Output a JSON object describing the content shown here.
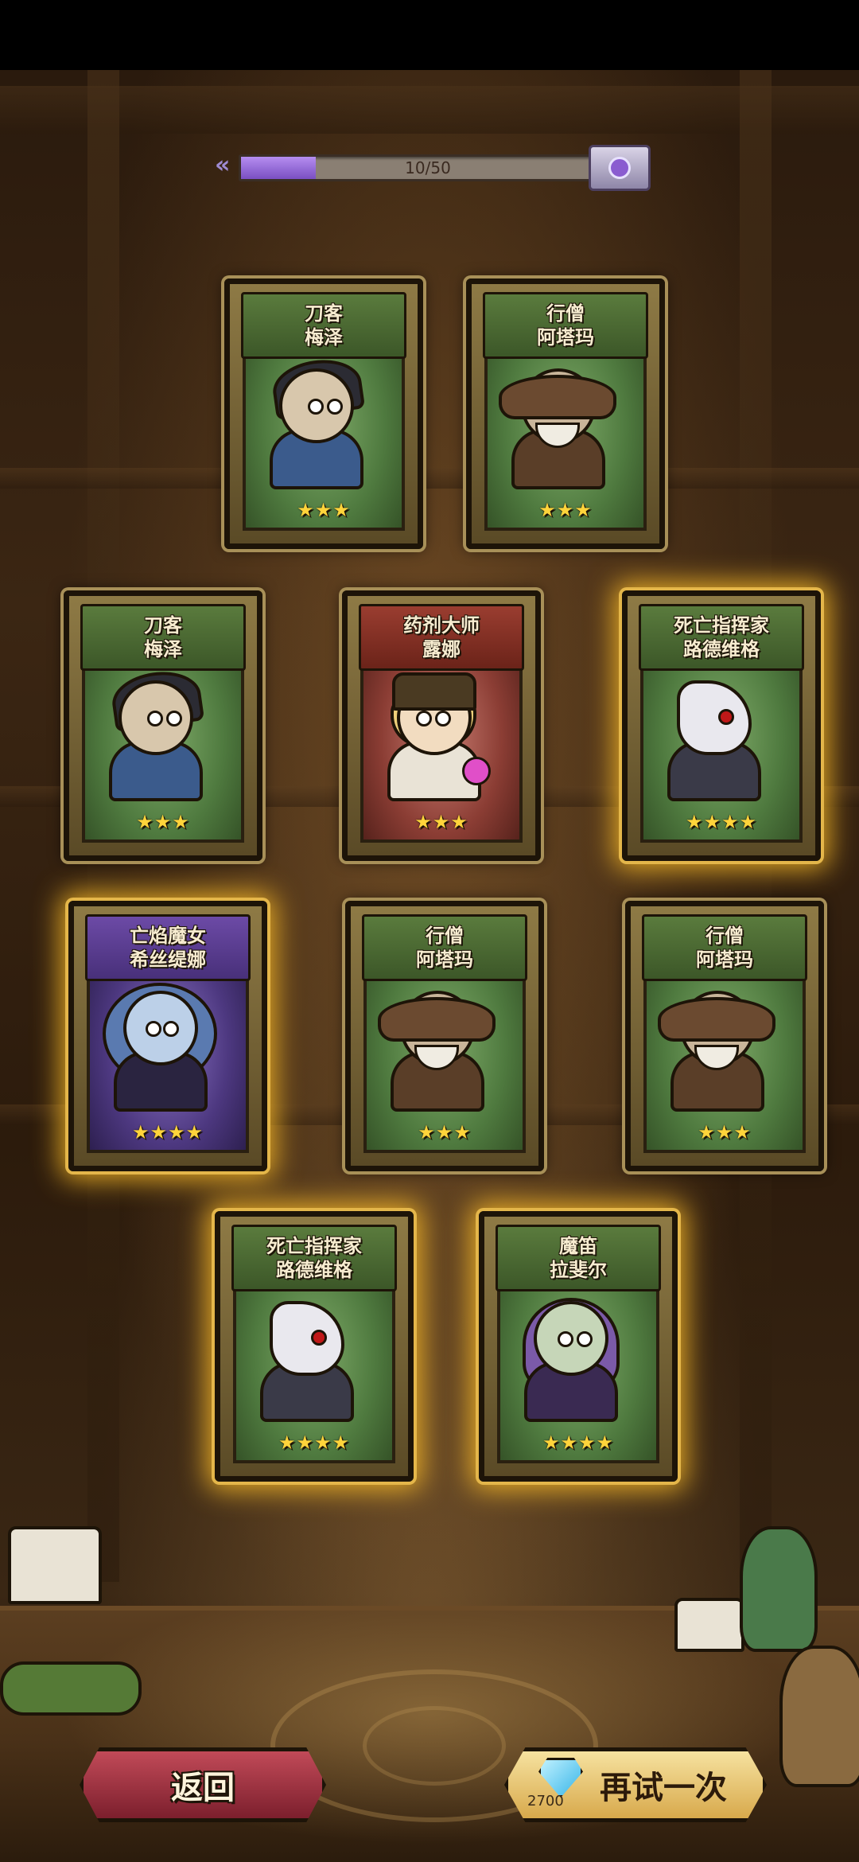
{
  "progress": {
    "text": "10/50",
    "fraction": 0.2
  },
  "cards": [
    {
      "id": "c1",
      "title": "刀客",
      "name": "梅泽",
      "stars": "★★★",
      "theme": "green",
      "gold": false,
      "portrait": "blade"
    },
    {
      "id": "c2",
      "title": "行僧",
      "name": "阿塔玛",
      "stars": "★★★",
      "theme": "green",
      "gold": false,
      "portrait": "monk"
    },
    {
      "id": "c3",
      "title": "刀客",
      "name": "梅泽",
      "stars": "★★★",
      "theme": "green",
      "gold": false,
      "portrait": "blade"
    },
    {
      "id": "c4",
      "title": "药剂大师",
      "name": "露娜",
      "stars": "★★★",
      "theme": "red",
      "gold": false,
      "portrait": "potion"
    },
    {
      "id": "c5",
      "title": "死亡指挥家",
      "name": "路德维格",
      "stars": "★★★★",
      "theme": "green",
      "gold": true,
      "portrait": "death"
    },
    {
      "id": "c6",
      "title": "亡焰魔女",
      "name": "希丝缇娜",
      "stars": "★★★★",
      "theme": "purple",
      "gold": true,
      "portrait": "witch"
    },
    {
      "id": "c7",
      "title": "行僧",
      "name": "阿塔玛",
      "stars": "★★★",
      "theme": "green",
      "gold": false,
      "portrait": "monk"
    },
    {
      "id": "c8",
      "title": "行僧",
      "name": "阿塔玛",
      "stars": "★★★",
      "theme": "green",
      "gold": false,
      "portrait": "monk"
    },
    {
      "id": "c9",
      "title": "死亡指挥家",
      "name": "路德维格",
      "stars": "★★★★",
      "theme": "green",
      "gold": true,
      "portrait": "death"
    },
    {
      "id": "c10",
      "title": "魔笛",
      "name": "拉斐尔",
      "stars": "★★★★",
      "theme": "green",
      "gold": true,
      "portrait": "flute"
    }
  ],
  "buttons": {
    "back_label": "返回",
    "retry_label": "再试一次",
    "retry_cost": "2700",
    "retry_cost_icon": "diamond-icon"
  }
}
